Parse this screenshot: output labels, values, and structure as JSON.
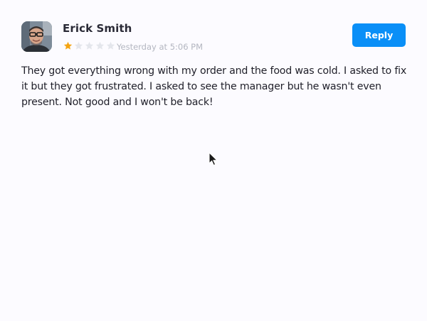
{
  "review": {
    "author": "Erick Smith",
    "rating": 1,
    "max_rating": 5,
    "timestamp": "Yesterday at 5:06 PM",
    "reply_label": "Reply",
    "text": "They got everything wrong with my order and the food was cold. I asked to fix it but they got frustrated. I asked to see the manager but he wasn't even present. Not good and I won't be back!"
  },
  "colors": {
    "accent": "#0a8ff7",
    "star_filled": "#f4a413",
    "star_empty": "#e4e6ec",
    "background": "#fcfbff"
  },
  "icons": {
    "avatar": "user-photo",
    "rating_star": "star-icon",
    "pointer": "mouse-cursor-icon"
  }
}
